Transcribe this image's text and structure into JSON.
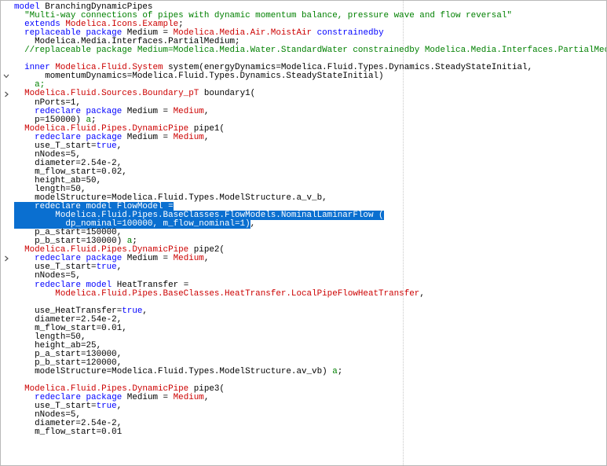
{
  "colors": {
    "keyword": "#0000ff",
    "class_ref": "#cc0000",
    "string": "#008000",
    "comment": "#008000",
    "selection": "#0a6fd0",
    "text": "#000000"
  },
  "gutter": {
    "fold_markers": [
      {
        "line": 9,
        "icon": "chevron-down-icon",
        "glyph": "v"
      },
      {
        "line": 11,
        "icon": "chevron-right-icon",
        "glyph": ">"
      },
      {
        "line": 30,
        "icon": "chevron-right-icon",
        "glyph": ">"
      }
    ]
  },
  "code_lines": [
    [
      [
        "kw",
        "model"
      ],
      [
        "plain",
        " BranchingDynamicPipes"
      ]
    ],
    [
      [
        "plain",
        "  "
      ],
      [
        "str",
        "\"Multi-way connections of pipes with dynamic momentum balance, pressure wave and flow reversal\""
      ]
    ],
    [
      [
        "plain",
        "  "
      ],
      [
        "kw",
        "extends"
      ],
      [
        "plain",
        " "
      ],
      [
        "cls",
        "Modelica.Icons.Example"
      ],
      [
        "plain",
        ";"
      ]
    ],
    [
      [
        "plain",
        "  "
      ],
      [
        "kw",
        "replaceable package"
      ],
      [
        "plain",
        " Medium = "
      ],
      [
        "cls",
        "Modelica.Media.Air.MoistAir"
      ],
      [
        "plain",
        " "
      ],
      [
        "kw",
        "constrainedby"
      ]
    ],
    [
      [
        "plain",
        "    Modelica.Media.Interfaces.PartialMedium;"
      ]
    ],
    [
      [
        "plain",
        "  "
      ],
      [
        "cmt",
        "//replaceable package Medium=Modelica.Media.Water.StandardWater constrainedby Modelica.Media.Interfaces.PartialMedium;"
      ]
    ],
    [],
    [
      [
        "plain",
        "  "
      ],
      [
        "kw",
        "inner"
      ],
      [
        "plain",
        " "
      ],
      [
        "cls",
        "Modelica.Fluid.System"
      ],
      [
        "plain",
        " system(energyDynamics=Modelica.Fluid.Types.Dynamics.SteadyStateInitial,"
      ]
    ],
    [
      [
        "plain",
        "      momentumDynamics=Modelica.Fluid.Types.Dynamics.SteadyStateInitial)"
      ]
    ],
    [
      [
        "plain",
        "    "
      ],
      [
        "cmt",
        "a;"
      ]
    ],
    [
      [
        "plain",
        "  "
      ],
      [
        "cls",
        "Modelica.Fluid.Sources.Boundary_pT"
      ],
      [
        "plain",
        " boundary1("
      ]
    ],
    [
      [
        "plain",
        "    nPorts=1,"
      ]
    ],
    [
      [
        "plain",
        "    "
      ],
      [
        "kw",
        "redeclare package"
      ],
      [
        "plain",
        " Medium = "
      ],
      [
        "cls",
        "Medium"
      ],
      [
        "plain",
        ","
      ]
    ],
    [
      [
        "plain",
        "    p=150000) "
      ],
      [
        "cmt",
        "a"
      ],
      [
        "plain",
        ";"
      ]
    ],
    [
      [
        "plain",
        "  "
      ],
      [
        "cls",
        "Modelica.Fluid.Pipes.DynamicPipe"
      ],
      [
        "plain",
        " pipe1("
      ]
    ],
    [
      [
        "plain",
        "    "
      ],
      [
        "kw",
        "redeclare package"
      ],
      [
        "plain",
        " Medium = "
      ],
      [
        "cls",
        "Medium"
      ],
      [
        "plain",
        ","
      ]
    ],
    [
      [
        "plain",
        "    use_T_start="
      ],
      [
        "kw",
        "true"
      ],
      [
        "plain",
        ","
      ]
    ],
    [
      [
        "plain",
        "    nNodes=5,"
      ]
    ],
    [
      [
        "plain",
        "    diameter=2.54e-2,"
      ]
    ],
    [
      [
        "plain",
        "    m_flow_start=0.02,"
      ]
    ],
    [
      [
        "plain",
        "    height_ab=50,"
      ]
    ],
    [
      [
        "plain",
        "    length=50,"
      ]
    ],
    [
      [
        "plain",
        "    modelStructure=Modelica.Fluid.Types.ModelStructure.a_v_b,"
      ]
    ],
    [
      [
        "sel",
        "    redeclare model FlowModel ="
      ]
    ],
    [
      [
        "sel",
        "        Modelica.Fluid.Pipes.BaseClasses.FlowModels.NominalLaminarFlow ("
      ]
    ],
    [
      [
        "sel",
        "          dp_nominal=100000, m_flow_nominal=1)"
      ],
      [
        "plain",
        ","
      ]
    ],
    [
      [
        "plain",
        "    p_a_start=150000,"
      ]
    ],
    [
      [
        "plain",
        "    p_b_start=130000) "
      ],
      [
        "cmt",
        "a"
      ],
      [
        "plain",
        ";"
      ]
    ],
    [
      [
        "plain",
        "  "
      ],
      [
        "cls",
        "Modelica.Fluid.Pipes.DynamicPipe"
      ],
      [
        "plain",
        " pipe2("
      ]
    ],
    [
      [
        "plain",
        "    "
      ],
      [
        "kw",
        "redeclare package"
      ],
      [
        "plain",
        " Medium = "
      ],
      [
        "cls",
        "Medium"
      ],
      [
        "plain",
        ","
      ]
    ],
    [
      [
        "plain",
        "    use_T_start="
      ],
      [
        "kw",
        "true"
      ],
      [
        "plain",
        ","
      ]
    ],
    [
      [
        "plain",
        "    nNodes=5,"
      ]
    ],
    [
      [
        "plain",
        "    "
      ],
      [
        "kw",
        "redeclare model"
      ],
      [
        "plain",
        " HeatTransfer ="
      ]
    ],
    [
      [
        "plain",
        "        "
      ],
      [
        "cls",
        "Modelica.Fluid.Pipes.BaseClasses.HeatTransfer.LocalPipeFlowHeatTransfer"
      ],
      [
        "plain",
        ","
      ]
    ],
    [],
    [
      [
        "plain",
        "    use_HeatTransfer="
      ],
      [
        "kw",
        "true"
      ],
      [
        "plain",
        ","
      ]
    ],
    [
      [
        "plain",
        "    diameter=2.54e-2,"
      ]
    ],
    [
      [
        "plain",
        "    m_flow_start=0.01,"
      ]
    ],
    [
      [
        "plain",
        "    length=50,"
      ]
    ],
    [
      [
        "plain",
        "    height_ab=25,"
      ]
    ],
    [
      [
        "plain",
        "    p_a_start=130000,"
      ]
    ],
    [
      [
        "plain",
        "    p_b_start=120000,"
      ]
    ],
    [
      [
        "plain",
        "    modelStructure=Modelica.Fluid.Types.ModelStructure.av_vb) "
      ],
      [
        "cmt",
        "a"
      ],
      [
        "plain",
        ";"
      ]
    ],
    [],
    [
      [
        "plain",
        "  "
      ],
      [
        "cls",
        "Modelica.Fluid.Pipes.DynamicPipe"
      ],
      [
        "plain",
        " pipe3("
      ]
    ],
    [
      [
        "plain",
        "    "
      ],
      [
        "kw",
        "redeclare package"
      ],
      [
        "plain",
        " Medium = "
      ],
      [
        "cls",
        "Medium"
      ],
      [
        "plain",
        ","
      ]
    ],
    [
      [
        "plain",
        "    use_T_start="
      ],
      [
        "kw",
        "true"
      ],
      [
        "plain",
        ","
      ]
    ],
    [
      [
        "plain",
        "    nNodes=5,"
      ]
    ],
    [
      [
        "plain",
        "    diameter=2.54e-2,"
      ]
    ],
    [
      [
        "plain",
        "    m_flow_start=0.01"
      ]
    ]
  ]
}
